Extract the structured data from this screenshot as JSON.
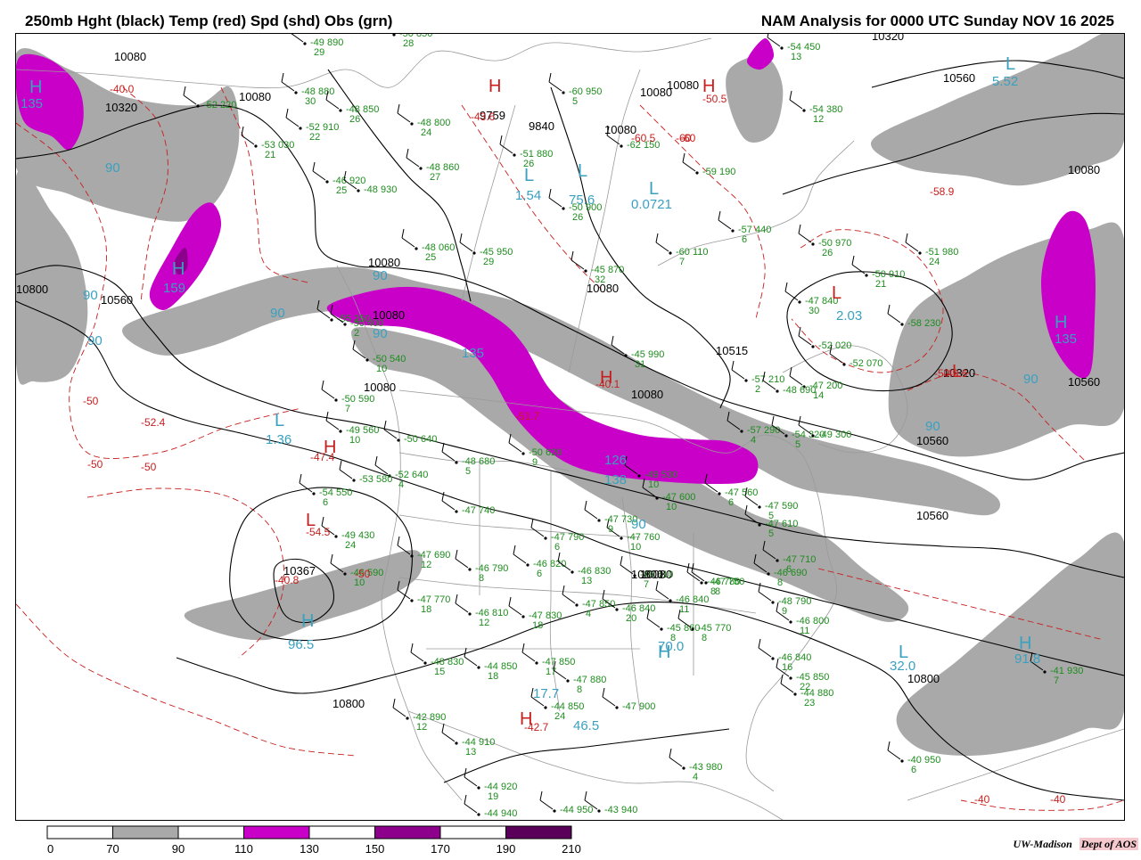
{
  "header": {
    "title_left": "250mb Hght (black) Temp (red) Spd (shd) Obs (grn)",
    "title_right": "NAM Analysis for 0000 UTC Sunday  NOV 16 2025"
  },
  "legend": {
    "ticks": [
      "0",
      "70",
      "90",
      "110",
      "130",
      "150",
      "170",
      "190",
      "210"
    ],
    "bins": [
      {
        "range": "0-70",
        "color": "#ffffff"
      },
      {
        "range": "70-90",
        "color": "#a9a9a9"
      },
      {
        "range": "90-110",
        "color": "#ffffff"
      },
      {
        "range": "110-130",
        "color": "#c800c8"
      },
      {
        "range": "130-150",
        "color": "#ffffff"
      },
      {
        "range": "150-170",
        "color": "#8c008c"
      },
      {
        "range": "170-190",
        "color": "#ffffff"
      },
      {
        "range": "190-210",
        "color": "#5a005a"
      }
    ]
  },
  "credit": {
    "org": "UW-Madison",
    "dept": "Dept of AOS"
  },
  "height_labels": [
    "10080",
    "10320",
    "10080",
    "10800",
    "10560",
    "10080",
    "10080",
    "10080",
    "10515",
    "10320",
    "10560",
    "10080",
    "10320",
    "10560",
    "10080",
    "10560",
    "10367",
    "10800",
    "10800",
    "10560",
    "10080",
    "10800",
    "9759",
    "9840",
    "10080",
    "10080",
    "10080",
    "10080"
  ],
  "temperature_labels": [
    "-40.0",
    "-50",
    "-52.4",
    "-50",
    "-47.4",
    "-54.5",
    "-40.8",
    "-50",
    "-50.5",
    "-43.6",
    "-60",
    "-60.5",
    "-60",
    "-58.9",
    "-40.1",
    "-51.7",
    "-50",
    "-49.6",
    "-50",
    "-42.7",
    "-40",
    "-40"
  ],
  "speed_labels": [
    "135",
    "90",
    "159",
    "90",
    "90",
    "90",
    "90",
    "135",
    "1.36",
    "96.5",
    "1.54",
    "75.6",
    "0.0721",
    "5.52",
    "90",
    "2.03",
    "135",
    "90",
    "90",
    "126",
    "138",
    "90",
    "70.0",
    "32.0",
    "91.8",
    "17.7",
    "46.5"
  ],
  "center_letters": [
    "H",
    "L",
    "H",
    "H",
    "L",
    "L",
    "H",
    "L",
    "L",
    "H",
    "L",
    "H",
    "L",
    "H",
    "H",
    "L",
    "L",
    "H",
    "H",
    "H"
  ],
  "observations": [
    {
      "t": "-49",
      "h": "890",
      "s": "29"
    },
    {
      "t": "-50",
      "h": "850",
      "s": "28"
    },
    {
      "t": "-52",
      "h": "220",
      "s": ""
    },
    {
      "t": "-48",
      "h": "880",
      "s": "30"
    },
    {
      "t": "-48",
      "h": "850",
      "s": "26"
    },
    {
      "t": "-52",
      "h": "910",
      "s": "22"
    },
    {
      "t": "-53",
      "h": "030",
      "s": "21"
    },
    {
      "t": "-48",
      "h": "800",
      "s": "24"
    },
    {
      "t": "-48",
      "h": "860",
      "s": "27"
    },
    {
      "t": "-46",
      "h": "920",
      "s": "25"
    },
    {
      "t": "-48",
      "h": "930",
      "s": ""
    },
    {
      "t": "-60",
      "h": "950",
      "s": "5"
    },
    {
      "t": "-51",
      "h": "880",
      "s": "26"
    },
    {
      "t": "-62",
      "h": "150",
      "s": ""
    },
    {
      "t": "-50",
      "h": "900",
      "s": "26"
    },
    {
      "t": "-54",
      "h": "450",
      "s": "13"
    },
    {
      "t": "-54",
      "h": "380",
      "s": "12"
    },
    {
      "t": "-59",
      "h": "190",
      "s": ""
    },
    {
      "t": "-57",
      "h": "440",
      "s": "6"
    },
    {
      "t": "-45",
      "h": "950",
      "s": "29"
    },
    {
      "t": "-48",
      "h": "060",
      "s": "25"
    },
    {
      "t": "-60",
      "h": "110",
      "s": "7"
    },
    {
      "t": "-45",
      "h": "870",
      "s": "32"
    },
    {
      "t": "-50",
      "h": "970",
      "s": "26"
    },
    {
      "t": "-51",
      "h": "980",
      "s": "24"
    },
    {
      "t": "-50",
      "h": "910",
      "s": "21"
    },
    {
      "t": "-47",
      "h": "840",
      "s": "30"
    },
    {
      "t": "-52",
      "h": "020",
      "s": ""
    },
    {
      "t": "-45",
      "h": "990",
      "s": "31"
    },
    {
      "t": "-57",
      "h": "210",
      "s": "2"
    },
    {
      "t": "-47",
      "h": "200",
      "s": "14"
    },
    {
      "t": "-52",
      "h": "070",
      "s": ""
    },
    {
      "t": "-50",
      "h": "540",
      "s": "10"
    },
    {
      "t": "-50",
      "h": "590",
      "s": "7"
    },
    {
      "t": "-49",
      "h": "560",
      "s": "10"
    },
    {
      "t": "-50",
      "h": "640",
      "s": ""
    },
    {
      "t": "-52",
      "h": "640",
      "s": "4"
    },
    {
      "t": "-53",
      "h": "580",
      "s": ""
    },
    {
      "t": "-48",
      "h": "680",
      "s": "5"
    },
    {
      "t": "-54",
      "h": "550",
      "s": "6"
    },
    {
      "t": "-49",
      "h": "430",
      "s": "24"
    },
    {
      "t": "-46",
      "h": "590",
      "s": "10"
    },
    {
      "t": "-47",
      "h": "740",
      "s": ""
    },
    {
      "t": "-47",
      "h": "690",
      "s": "12"
    },
    {
      "t": "-47",
      "h": "790",
      "s": "6"
    },
    {
      "t": "-47",
      "h": "760",
      "s": "10"
    },
    {
      "t": "-46",
      "h": "790",
      "s": "8"
    },
    {
      "t": "-46",
      "h": "820",
      "s": "6"
    },
    {
      "t": "-46",
      "h": "830",
      "s": "13"
    },
    {
      "t": "-46",
      "h": "810",
      "s": "7"
    },
    {
      "t": "-47",
      "h": "770",
      "s": "18"
    },
    {
      "t": "-46",
      "h": "810",
      "s": "12"
    },
    {
      "t": "-47",
      "h": "830",
      "s": "18"
    },
    {
      "t": "-47",
      "h": "850",
      "s": "4"
    },
    {
      "t": "-46",
      "h": "840",
      "s": "20"
    },
    {
      "t": "-46",
      "h": "840",
      "s": "11"
    },
    {
      "t": "-45",
      "h": "860",
      "s": "8"
    },
    {
      "t": "-47",
      "h": "750",
      "s": "8"
    },
    {
      "t": "-45",
      "h": "770",
      "s": "8"
    },
    {
      "t": "-48",
      "h": "790",
      "s": "9"
    },
    {
      "t": "-46",
      "h": "800",
      "s": "11"
    },
    {
      "t": "-46",
      "h": "840",
      "s": "16"
    },
    {
      "t": "-45",
      "h": "850",
      "s": "22"
    },
    {
      "t": "-44",
      "h": "880",
      "s": "23"
    },
    {
      "t": "-48",
      "h": "830",
      "s": "15"
    },
    {
      "t": "-44",
      "h": "850",
      "s": "18"
    },
    {
      "t": "-47",
      "h": "850",
      "s": "17"
    },
    {
      "t": "-47",
      "h": "880",
      "s": "8"
    },
    {
      "t": "-44",
      "h": "850",
      "s": "24"
    },
    {
      "t": "-47",
      "h": "900",
      "s": ""
    },
    {
      "t": "-42",
      "h": "890",
      "s": "12"
    },
    {
      "t": "-44",
      "h": "910",
      "s": "13"
    },
    {
      "t": "-44",
      "h": "920",
      "s": "19"
    },
    {
      "t": "-44",
      "h": "940",
      "s": ""
    },
    {
      "t": "-44",
      "h": "950",
      "s": ""
    },
    {
      "t": "-43",
      "h": "940",
      "s": ""
    },
    {
      "t": "-43",
      "h": "980",
      "s": "4"
    },
    {
      "t": "-40",
      "h": "950",
      "s": "6"
    },
    {
      "t": "-41",
      "h": "930",
      "s": "7"
    },
    {
      "t": "-47",
      "h": "730",
      "s": "9"
    },
    {
      "t": "-47",
      "h": "560",
      "s": "6"
    },
    {
      "t": "-47",
      "h": "590",
      "s": "5"
    },
    {
      "t": "-47",
      "h": "610",
      "s": "5"
    },
    {
      "t": "-49",
      "h": "530",
      "s": "10"
    },
    {
      "t": "-47",
      "h": "600",
      "s": "10"
    },
    {
      "t": "-50",
      "h": "620",
      "s": "9"
    },
    {
      "t": "-47",
      "h": "710",
      "s": "6"
    },
    {
      "t": "-46",
      "h": "690",
      "s": "8"
    },
    {
      "t": "-46",
      "h": "780",
      "s": "8"
    },
    {
      "t": "-48",
      "h": "690",
      "s": ""
    },
    {
      "t": "-57",
      "h": "290",
      "s": "4"
    },
    {
      "t": "-54",
      "h": "320",
      "s": "5"
    },
    {
      "t": "-49",
      "h": "300",
      "s": ""
    },
    {
      "t": "-58",
      "h": "230",
      "s": ""
    },
    {
      "t": "-55",
      "h": "250",
      "s": ""
    },
    {
      "t": "-50",
      "h": "400",
      "s": "2"
    },
    {
      "t": "-52",
      "h": "460",
      "s": "6"
    }
  ]
}
